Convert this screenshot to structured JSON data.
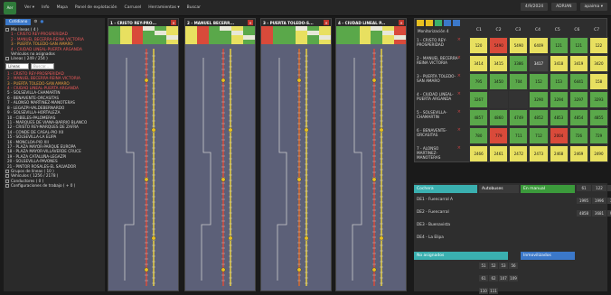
{
  "topbar": {
    "logo": "Aer",
    "menu": [
      "Ver ▾",
      "Info",
      "Mapa",
      "Panel de explotación",
      "Carrusel",
      "Herramientas ▾",
      "Buscar"
    ],
    "date": "4/9/2024",
    "user": "ADRIAN",
    "account": "apaima ▾"
  },
  "sidebar": {
    "tab": "Cotidiano",
    "my_lines": "Mis líneas ( 4 )",
    "my_lines_items": [
      "1 - CRISTO REY-PROSPERIDAD",
      "2 - MANUEL BECERRA-REINA VICTORIA",
      "3 - PUERTA TOLEDO-SAN AMARO",
      "4 - CIUDAD LINEAL-PUERTA ARGANDA"
    ],
    "unassigned": "Vehículos no asignados",
    "lines_header": "Líneas ( 249 / 254 )",
    "filter_label": "Líneas",
    "search_placeholder": "Buscar...",
    "lines": [
      "1 - CRISTO REY-PROSPERIDAD",
      "2 - MANUEL BECERRA-REINA VICTORIA",
      "3 - PUERTA TOLEDO-SAN AMARO",
      "4 - CIUDAD LINEAL-PUERTA ARGANDA",
      "5 - SOLSEVILLA-CHAMARTIN",
      "6 - BENAVENTE-ORCASITAS",
      "7 - ALONSO MARTINEZ-MANOTERAS",
      "8 - LEGAZPI-VALDEBERNARDO",
      "9 - SOLSEVILLA-HORTALEZA",
      "10 - CIBELES-PALOMERAS",
      "11 - MARQUES DE VIANA-BARRIO BLANCO",
      "12 - CRISTO REY-MARQUES DE ZAFRA",
      "14 - CONDE DE CASAL-PIO XII",
      "15 - SOLSEVILLA-LA ELIPA",
      "16 - MONCLOA-PIO XII",
      "17 - PLAZA MAYOR-PARQUE EUROPA",
      "18 - PLAZA MAYOR-VILLAVERDE CRUCE",
      "19 - PLAZA CATALUÑA-LEGAZPI",
      "20 - SOLSEVILLA-PAVONES",
      "21 - PINTOR ROSALES-EL SALVADOR"
    ],
    "groups": "Grupos de líneas ( 10 )",
    "vehicles": "Vehículos ( 1256 / 2178 )",
    "conductors": "Conductores ( 0 )",
    "config": "Configuraciones de trabajo ( + 0 )"
  },
  "panels": [
    {
      "title": "1 - CRISTO REY-PRO...",
      "line_color": "#d94a3a"
    },
    {
      "title": "2 - MANUEL BECERR...",
      "line_color": "#d94a3a"
    },
    {
      "title": "3 - PUERTA TOLEDO-S...",
      "line_color": "#d96a2a"
    },
    {
      "title": "4 - CIUDAD LINEAL P...",
      "line_color": "#d94a3a"
    }
  ],
  "grid": {
    "subtitle": "Monitorización",
    "subtitle_count": "4",
    "columns": [
      "C1",
      "C2",
      "C3",
      "C4",
      "C5",
      "C6",
      "C7"
    ],
    "rows": [
      {
        "label": "1 - CRISTO REY-PROSPERIDAD",
        "cells": [
          {
            "v": "120",
            "c": "#e8e060"
          },
          {
            "v": "5490",
            "c": "#d94a3a"
          },
          {
            "v": "5490",
            "c": "#e8e060"
          },
          {
            "v": "6409",
            "c": "#e8e060"
          },
          {
            "v": "121",
            "c": "#5aa84a"
          },
          {
            "v": "121",
            "c": "#5aa84a"
          },
          {
            "v": "122",
            "c": "#e8e060"
          }
        ]
      },
      {
        "label": "2 - MANUEL BECERRA-REINA VICTORIA",
        "cells": [
          {
            "v": "3414",
            "c": "#e8e060"
          },
          {
            "v": "3415",
            "c": "#e8e060"
          },
          {
            "v": "3386",
            "c": "#5aa84a"
          },
          {
            "v": "3417",
            "c": "#444"
          },
          {
            "v": "3418",
            "c": "#e8e060"
          },
          {
            "v": "3419",
            "c": "#e8e060"
          },
          {
            "v": "3420",
            "c": "#e8e060"
          }
        ]
      },
      {
        "label": "3 - PUERTA TOLEDO-SAN AMARO",
        "cells": [
          {
            "v": "795",
            "c": "#5aa84a"
          },
          {
            "v": "3450",
            "c": "#5aa84a"
          },
          {
            "v": "704",
            "c": "#5aa84a"
          },
          {
            "v": "152",
            "c": "#5aa84a"
          },
          {
            "v": "153",
            "c": "#5aa84a"
          },
          {
            "v": "6441",
            "c": "#5aa84a"
          },
          {
            "v": "158",
            "c": "#e8e060"
          }
        ]
      },
      {
        "label": "4 - CIUDAD LINEAL-PUERTA ARGANDA",
        "cells": [
          {
            "v": "3267",
            "c": "#5aa84a"
          },
          {
            "v": "",
            "c": "#333"
          },
          {
            "v": "",
            "c": "#333"
          },
          {
            "v": "3290",
            "c": "#5aa84a"
          },
          {
            "v": "3294",
            "c": "#5aa84a"
          },
          {
            "v": "3297",
            "c": "#5aa84a"
          },
          {
            "v": "3293",
            "c": "#5aa84a"
          }
        ]
      },
      {
        "label": "5 - SOLSEVILLA-CHAMARTIN",
        "cells": [
          {
            "v": "4857",
            "c": "#5aa84a"
          },
          {
            "v": "4860",
            "c": "#5aa84a"
          },
          {
            "v": "4749",
            "c": "#5aa84a"
          },
          {
            "v": "4852",
            "c": "#5aa84a"
          },
          {
            "v": "4853",
            "c": "#5aa84a"
          },
          {
            "v": "4854",
            "c": "#5aa84a"
          },
          {
            "v": "4855",
            "c": "#5aa84a"
          }
        ]
      },
      {
        "label": "6 - BENAVENTE-ORCASITAS",
        "cells": [
          {
            "v": "780",
            "c": "#5aa84a"
          },
          {
            "v": "779",
            "c": "#d94a3a"
          },
          {
            "v": "711",
            "c": "#5aa84a"
          },
          {
            "v": "712",
            "c": "#5aa84a"
          },
          {
            "v": "2004",
            "c": "#d94a3a"
          },
          {
            "v": "726",
            "c": "#5aa84a"
          },
          {
            "v": "729",
            "c": "#5aa84a"
          }
        ]
      },
      {
        "label": "7 - ALONSO MARTINEZ-MANOTERAS",
        "cells": [
          {
            "v": "2466",
            "c": "#e8e060"
          },
          {
            "v": "2461",
            "c": "#e8e060"
          },
          {
            "v": "2472",
            "c": "#e8e060"
          },
          {
            "v": "2473",
            "c": "#e8e060"
          },
          {
            "v": "2468",
            "c": "#e8e060"
          },
          {
            "v": "2469",
            "c": "#e8e060"
          },
          {
            "v": "2490",
            "c": "#e8e060"
          }
        ]
      }
    ]
  },
  "bottom": {
    "cochera": "Cochera",
    "autobuses": "Autobuses",
    "en_manual": "En manual",
    "depots": [
      "DE1 - Fuencarral A",
      "DE2 - Fuencarral",
      "DE3 - Buenavista",
      "DE4 - La Elipa"
    ],
    "no_asignados": "No asignados",
    "inmovilizados": "Inmovilizados",
    "manual_values": [
      "61",
      "122",
      "79",
      "1995",
      "1996",
      "3303",
      "4858",
      "3681",
      "9124"
    ],
    "noasig_values": [
      "51",
      "52",
      "53",
      "56",
      "61",
      "62",
      "107",
      "109",
      "110",
      "111"
    ]
  }
}
